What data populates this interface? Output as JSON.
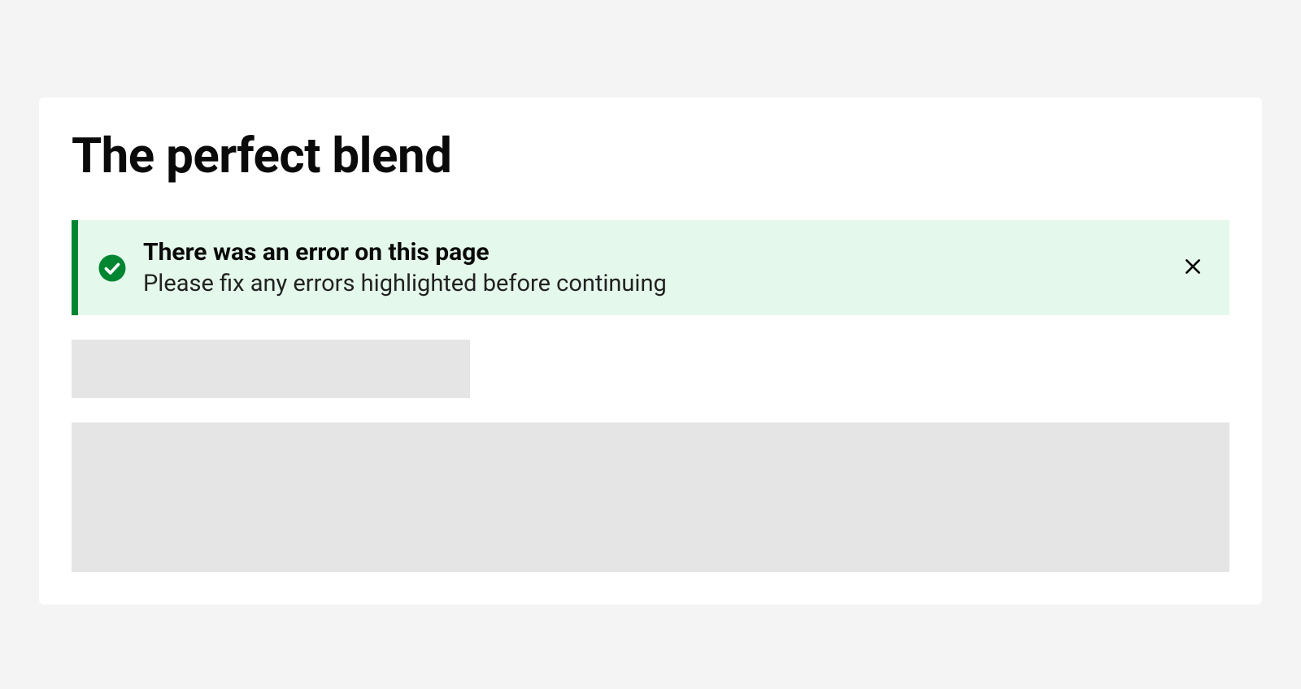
{
  "page": {
    "title": "The perfect blend"
  },
  "alert": {
    "title": "There was an error on this page",
    "message": "Please fix any errors highlighted before continuing"
  }
}
